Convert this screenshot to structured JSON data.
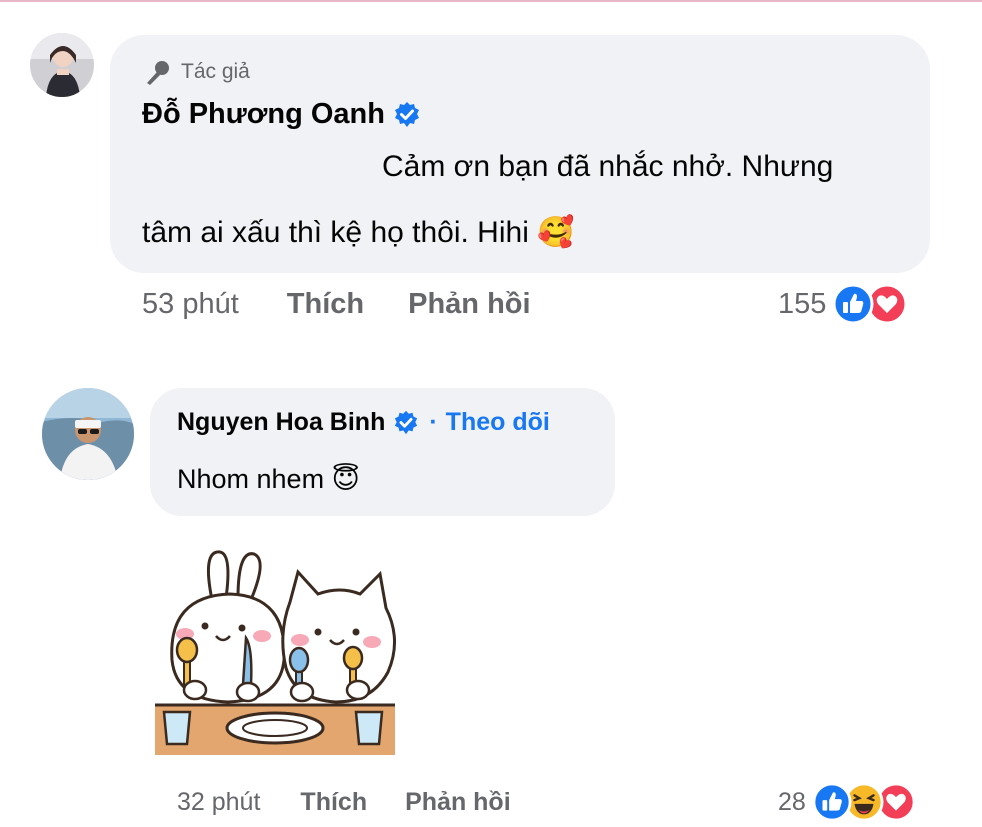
{
  "colors": {
    "bubble_bg": "#f0f2f5",
    "meta_text": "#65676b",
    "link_blue": "#1877f2",
    "like_blue": "#1877f2",
    "love_red": "#f33e58",
    "haha_yellow": "#f7b928"
  },
  "comments": [
    {
      "badge_icon": "microphone-icon",
      "badge_label": "Tác giả",
      "author": "Đỗ Phương Oanh",
      "verified": true,
      "text_line1": "Cảm ơn bạn đã nhắc nhở. Nhưng",
      "text_line2": "tâm ai xấu thì kệ họ thôi. Hihi",
      "emoji": "🥰",
      "time": "53 phút",
      "like_label": "Thích",
      "reply_label": "Phản hồi",
      "reaction_count": "155",
      "reactions": [
        "like-icon",
        "love-icon"
      ]
    },
    {
      "author": "Nguyen Hoa Binh",
      "verified": true,
      "separator": "·",
      "follow_label": "Theo dõi",
      "text": "Nhom nhem",
      "emoji": "😇",
      "sticker": "bunny-and-cat-eating-sticker",
      "time": "32 phút",
      "like_label": "Thích",
      "reply_label": "Phản hồi",
      "reaction_count": "28",
      "reactions": [
        "like-icon",
        "haha-icon",
        "love-icon"
      ]
    }
  ]
}
